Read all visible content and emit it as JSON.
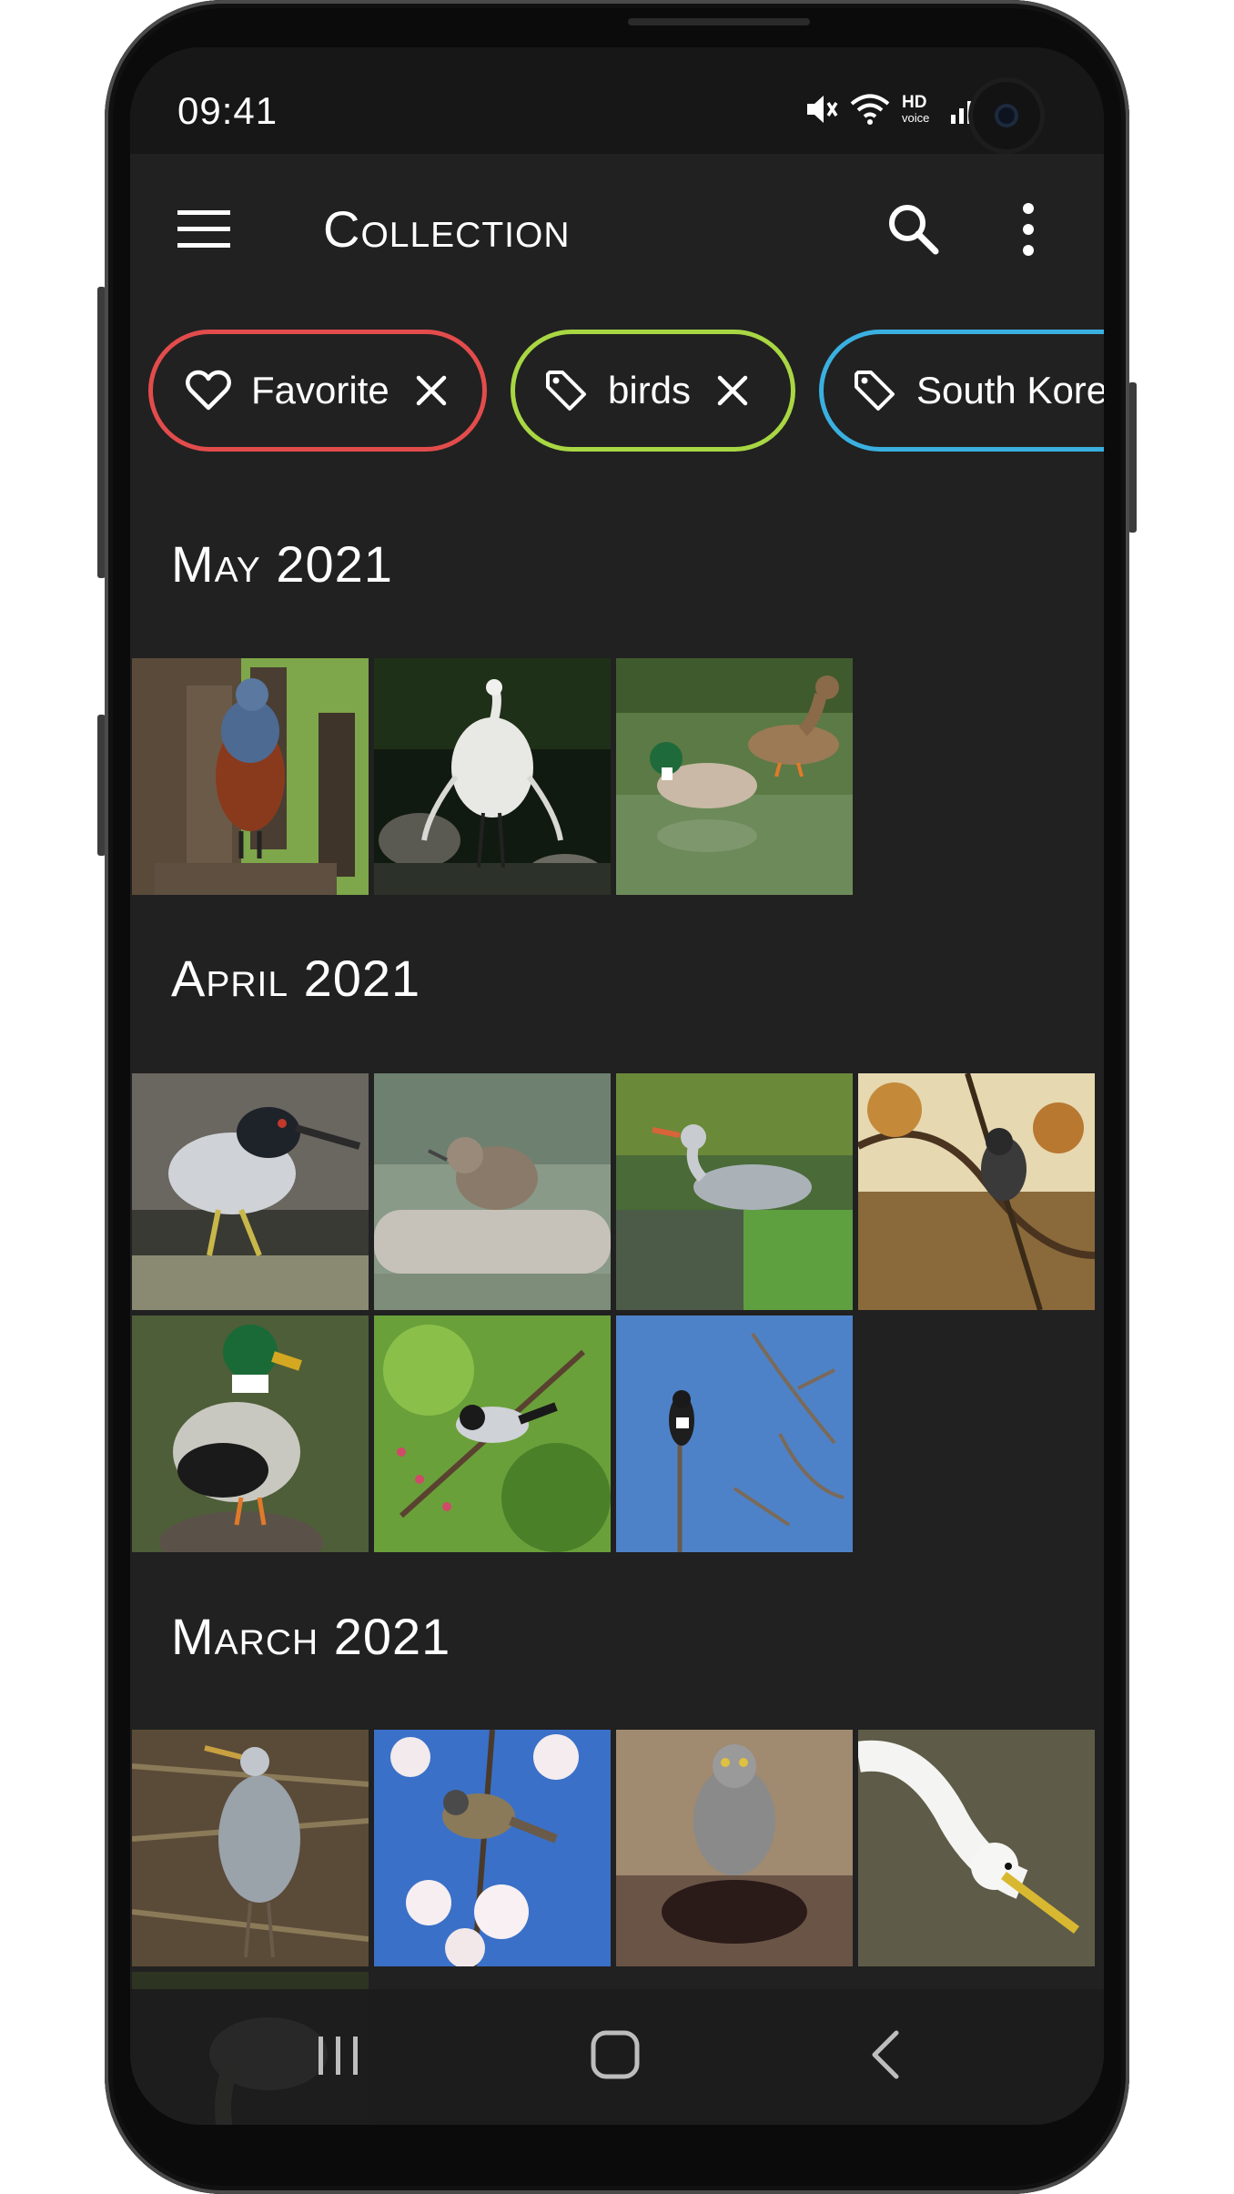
{
  "status_bar": {
    "time": "09:41",
    "network_label": "HD voice",
    "icons": [
      "mute-icon",
      "wifi-icon",
      "hd-voice-icon",
      "signal-icon",
      "battery-icon"
    ]
  },
  "app_bar": {
    "title": "Collection",
    "icons": [
      "menu-icon",
      "search-icon",
      "more-vert-icon"
    ]
  },
  "filters": [
    {
      "label": "Favorite",
      "icon": "heart-icon",
      "color": "#e34c4c"
    },
    {
      "label": "birds",
      "icon": "tag-icon",
      "color": "#a8d743"
    },
    {
      "label": "South Kore",
      "icon": "tag-icon",
      "color": "#3ab0e0"
    }
  ],
  "sections": [
    {
      "title": "May 2021",
      "photo_count": 3
    },
    {
      "title": "April 2021",
      "photo_count": 7
    },
    {
      "title": "March 2021",
      "photo_count": 5
    }
  ],
  "colors": {
    "background": "#212121",
    "status_bar": "#171717",
    "text": "#ffffff"
  },
  "nav_bar": {
    "icons": [
      "recents-icon",
      "home-icon",
      "back-icon"
    ]
  }
}
